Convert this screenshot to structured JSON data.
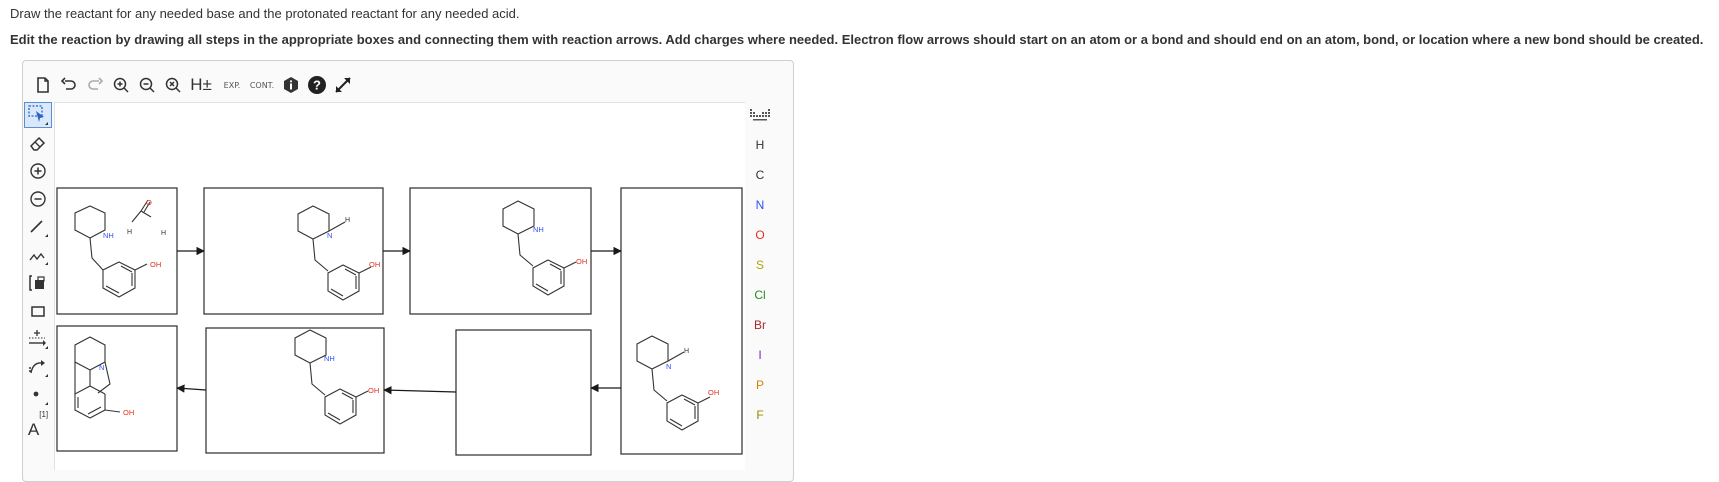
{
  "instructions": {
    "line1": "Draw the reactant for any needed base and the protonated reactant for any needed acid.",
    "line2": "Edit the reaction by drawing all steps in the appropriate boxes and connecting them with reaction arrows. Add charges where needed. Electron flow arrows should start on an atom or a bond and should end on an atom, bond, or location where a new bond should be created."
  },
  "toolbar_top": {
    "hydrogen_label": "H±",
    "exp_label": "EXP.",
    "cont_label": "CONT."
  },
  "toolbar_left": {
    "text_tool_label": "A",
    "text_tool_sup": "[1]"
  },
  "atoms": [
    "H",
    "C",
    "N",
    "O",
    "S",
    "Cl",
    "Br",
    "I",
    "P",
    "F"
  ],
  "atom_colors": {
    "H": "#333333",
    "C": "#333333",
    "N": "#3050f8",
    "O": "#e0301e",
    "S": "#b8a200",
    "Cl": "#1f8f1f",
    "Br": "#a52a2a",
    "I": "#7d2ab8",
    "P": "#d48500",
    "F": "#9a8a00"
  },
  "molecule_labels": {
    "nh": "NH",
    "oh": "OH",
    "h": "H",
    "n": "N",
    "o": "O"
  }
}
